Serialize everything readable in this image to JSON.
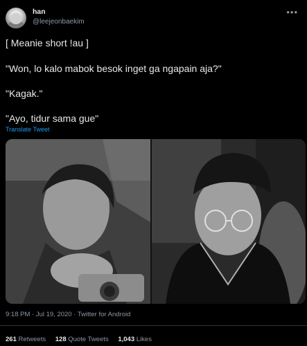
{
  "author": {
    "display_name": "han",
    "handle": "@leejeonbaekim"
  },
  "tweet": {
    "lines": [
      "[ Meanie short !au ]",
      "\"Won, lo kalo mabok besok inget ga ngapain aja?\"",
      "\"Kagak.\"",
      "\"Ayo, tidur sama gue\""
    ],
    "translate_label": "Translate Tweet"
  },
  "meta": {
    "timestamp": "9:18 PM · Jul 19, 2020 · Twitter for Android"
  },
  "stats": {
    "retweets_count": "261",
    "retweets_label": "Retweets",
    "quotes_count": "128",
    "quotes_label": "Quote Tweets",
    "likes_count": "1,043",
    "likes_label": "Likes"
  },
  "icons": {
    "more": "more-options-icon"
  }
}
